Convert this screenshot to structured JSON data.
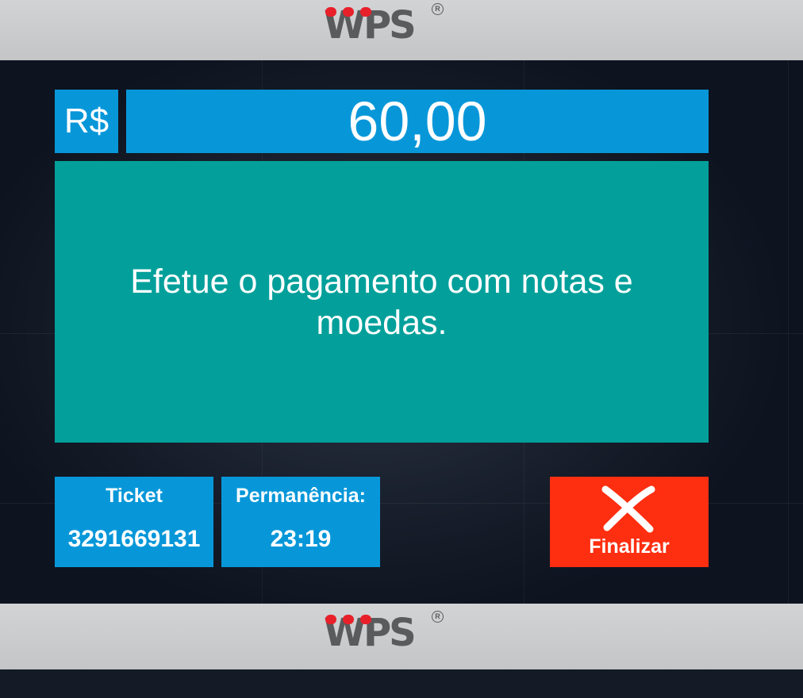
{
  "header": {
    "logo_text": "WPS",
    "logo_icon": "wps-logo"
  },
  "footer": {
    "logo_text": "WPS",
    "logo_icon": "wps-logo"
  },
  "payment": {
    "currency": "R$",
    "amount": "60,00",
    "message": "Efetue o pagamento com notas e moedas."
  },
  "ticket": {
    "label": "Ticket",
    "value": "3291669131"
  },
  "stay": {
    "label": "Permanência:",
    "value": "23:19"
  },
  "finish_button": {
    "label": "Finalizar",
    "icon": "close-icon"
  },
  "colors": {
    "blue": "#0797d9",
    "teal": "#03a09b",
    "red": "#fe2e10",
    "bar_gray": "#c9cacc",
    "logo_red": "#e8202a",
    "logo_gray": "#5a5b5d"
  }
}
